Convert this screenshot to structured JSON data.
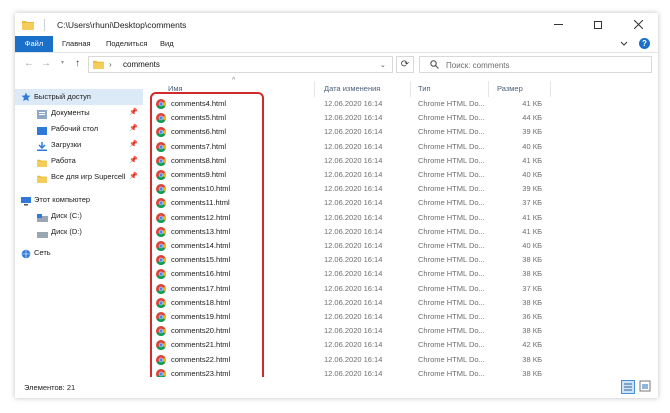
{
  "window": {
    "title": "C:\\Users\\rhuni\\Desktop\\comments"
  },
  "ribbon": {
    "tabs": [
      "Файл",
      "Главная",
      "Поделиться",
      "Вид"
    ]
  },
  "address": {
    "path": "comments"
  },
  "search": {
    "placeholder": "Поиск: comments"
  },
  "sidebar": {
    "items": [
      {
        "label": "Быстрый доступ",
        "icon": "star-icon"
      },
      {
        "label": "Документы",
        "icon": "documents-icon"
      },
      {
        "label": "Рабочий стол",
        "icon": "desktop-icon"
      },
      {
        "label": "Загрузки",
        "icon": "downloads-icon"
      },
      {
        "label": "Работа",
        "icon": "folder-icon"
      },
      {
        "label": "Все для игр Supercell",
        "icon": "folder-icon"
      },
      {
        "label": "Этот компьютер",
        "icon": "computer-icon"
      },
      {
        "label": "Диск (C:)",
        "icon": "drive-icon"
      },
      {
        "label": "Диск (D:)",
        "icon": "drive-icon"
      },
      {
        "label": "Сеть",
        "icon": "network-icon"
      }
    ]
  },
  "columns": {
    "name": "Имя",
    "date": "Дата изменения",
    "type": "Тип",
    "size": "Размер"
  },
  "files": [
    {
      "name": "comments4.html",
      "date": "12.06.2020 16:14",
      "type": "Chrome HTML Do...",
      "size": "41 КБ"
    },
    {
      "name": "comments5.html",
      "date": "12.06.2020 16:14",
      "type": "Chrome HTML Do...",
      "size": "44 КБ"
    },
    {
      "name": "comments6.html",
      "date": "12.06.2020 16:14",
      "type": "Chrome HTML Do...",
      "size": "39 КБ"
    },
    {
      "name": "comments7.html",
      "date": "12.06.2020 16:14",
      "type": "Chrome HTML Do...",
      "size": "40 КБ"
    },
    {
      "name": "comments8.html",
      "date": "12.06.2020 16:14",
      "type": "Chrome HTML Do...",
      "size": "41 КБ"
    },
    {
      "name": "comments9.html",
      "date": "12.06.2020 16:14",
      "type": "Chrome HTML Do...",
      "size": "40 КБ"
    },
    {
      "name": "comments10.html",
      "date": "12.06.2020 16:14",
      "type": "Chrome HTML Do...",
      "size": "39 КБ"
    },
    {
      "name": "comments11.html",
      "date": "12.06.2020 16:14",
      "type": "Chrome HTML Do...",
      "size": "37 КБ"
    },
    {
      "name": "comments12.html",
      "date": "12.06.2020 16:14",
      "type": "Chrome HTML Do...",
      "size": "41 КБ"
    },
    {
      "name": "comments13.html",
      "date": "12.06.2020 16:14",
      "type": "Chrome HTML Do...",
      "size": "41 КБ"
    },
    {
      "name": "comments14.html",
      "date": "12.06.2020 16:14",
      "type": "Chrome HTML Do...",
      "size": "40 КБ"
    },
    {
      "name": "comments15.html",
      "date": "12.06.2020 16:14",
      "type": "Chrome HTML Do...",
      "size": "38 КБ"
    },
    {
      "name": "comments16.html",
      "date": "12.06.2020 16:14",
      "type": "Chrome HTML Do...",
      "size": "38 КБ"
    },
    {
      "name": "comments17.html",
      "date": "12.06.2020 16:14",
      "type": "Chrome HTML Do...",
      "size": "37 КБ"
    },
    {
      "name": "comments18.html",
      "date": "12.06.2020 16:14",
      "type": "Chrome HTML Do...",
      "size": "38 КБ"
    },
    {
      "name": "comments19.html",
      "date": "12.06.2020 16:14",
      "type": "Chrome HTML Do...",
      "size": "36 КБ"
    },
    {
      "name": "comments20.html",
      "date": "12.06.2020 16:14",
      "type": "Chrome HTML Do...",
      "size": "38 КБ"
    },
    {
      "name": "comments21.html",
      "date": "12.06.2020 16:14",
      "type": "Chrome HTML Do...",
      "size": "42 КБ"
    },
    {
      "name": "comments22.html",
      "date": "12.06.2020 16:14",
      "type": "Chrome HTML Do...",
      "size": "38 КБ"
    },
    {
      "name": "comments23.html",
      "date": "12.06.2020 16:14",
      "type": "Chrome HTML Do...",
      "size": "38 КБ"
    }
  ],
  "status": {
    "count": "Элементов: 21"
  },
  "colors": {
    "accent": "#1a6fc9",
    "highlight": "#cf2b2b",
    "selection": "#dce9f7"
  }
}
